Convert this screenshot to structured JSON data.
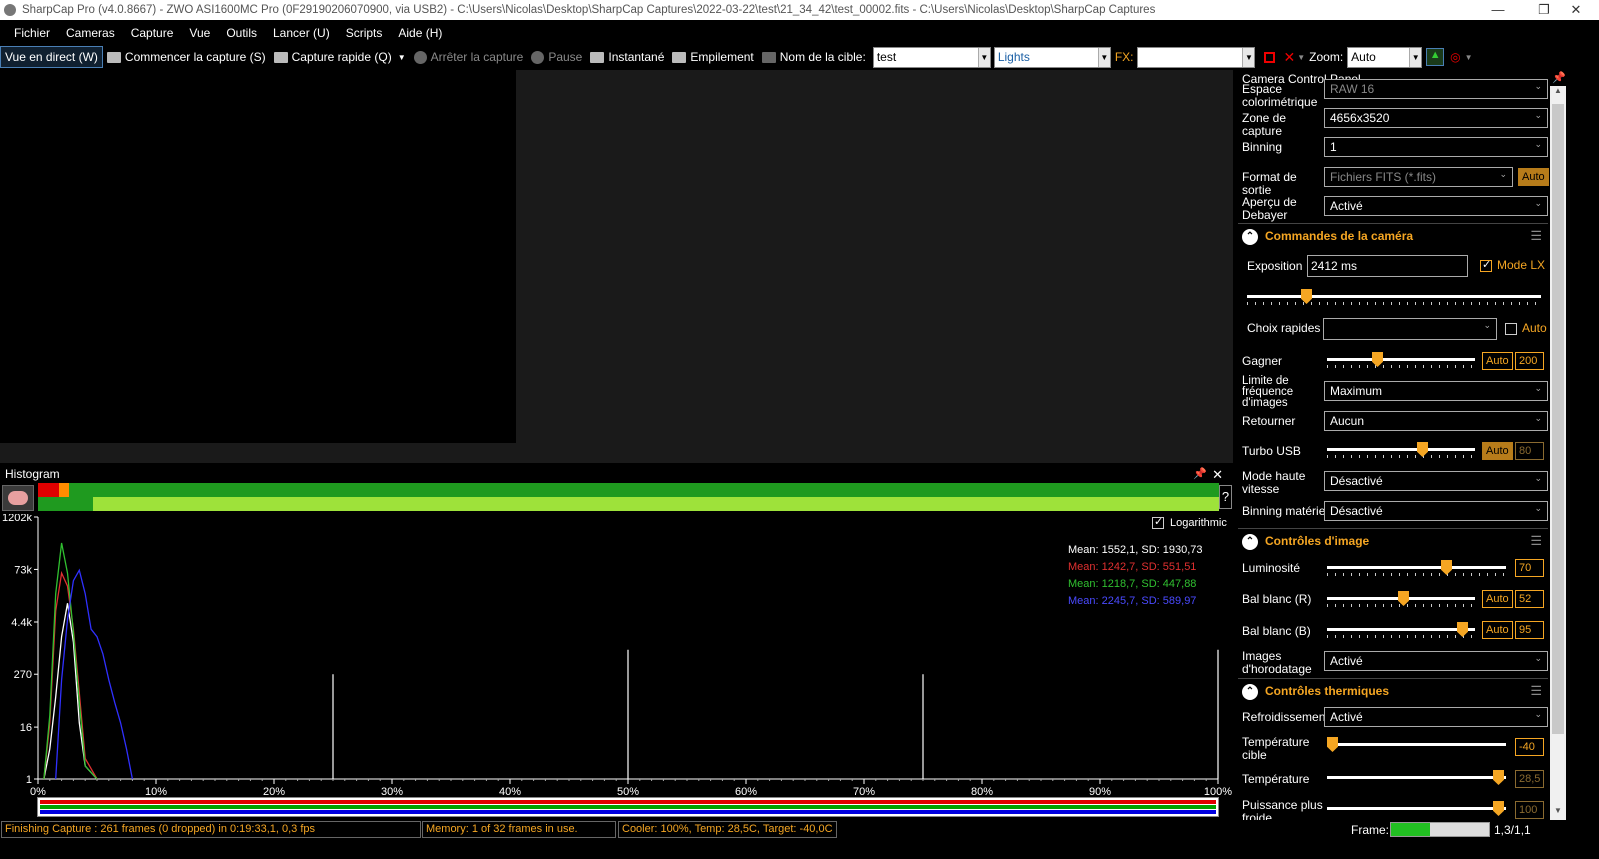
{
  "titlebar": {
    "title": "SharpCap Pro (v4.0.8667) - ZWO ASI1600MC Pro (0F29190206070900, via USB2) - C:\\Users\\Nicolas\\Desktop\\SharpCap Captures\\2022-03-22\\test\\21_34_42\\test_00002.fits - C:\\Users\\Nicolas\\Desktop\\SharpCap Captures",
    "minimize": "—",
    "maximize": "❐",
    "close": "✕"
  },
  "menu": [
    "Fichier",
    "Cameras",
    "Capture",
    "Vue",
    "Outils",
    "Lancer (U)",
    "Scripts",
    "Aide (H)"
  ],
  "toolbar": {
    "live_view": "Vue en direct (W)",
    "start_capture": "Commencer la capture (S)",
    "quick_capture": "Capture rapide (Q)",
    "stop_capture": "Arrêter la capture",
    "pause": "Pause",
    "snapshot": "Instantané",
    "stacking": "Empilement",
    "target_label": "Nom de la cible:",
    "target_value": "test",
    "frame_type": "Lights",
    "fx_label": "FX:",
    "fx_value": "",
    "zoom_label": "Zoom:",
    "zoom_value": "Auto"
  },
  "histogram": {
    "title": "Histogram",
    "pin": "📌",
    "close": "✕",
    "help": "?",
    "logarithmic_label": "Logarithmic",
    "logarithmic": true,
    "stats": [
      {
        "text": "Mean: 1552,1, SD: 1930,73",
        "color": "#ffffff"
      },
      {
        "text": "Mean: 1242,7, SD: 551,51",
        "color": "#e03030"
      },
      {
        "text": "Mean: 1218,7, SD: 447,88",
        "color": "#30c030"
      },
      {
        "text": "Mean: 2245,7, SD: 589,97",
        "color": "#4040ff"
      }
    ]
  },
  "chart_data": {
    "type": "line",
    "x_ticks": [
      "0%",
      "10%",
      "20%",
      "30%",
      "40%",
      "50%",
      "60%",
      "70%",
      "80%",
      "90%",
      "100%"
    ],
    "y_ticks": [
      "1202k",
      "73k",
      "4.4k",
      "270",
      "16",
      "1"
    ],
    "xlim": [
      0,
      100
    ],
    "log_scale": true,
    "series": [
      {
        "color": "#ffffff",
        "x": [
          0.5,
          1,
          1.5,
          2,
          2.5,
          3,
          3.5,
          4,
          5
        ],
        "y": [
          1,
          5,
          80,
          2000,
          12000,
          1500,
          20,
          2,
          1
        ]
      },
      {
        "color": "#e03030",
        "x": [
          0.5,
          1,
          1.5,
          2,
          2.5,
          3,
          3.5,
          4,
          5
        ],
        "y": [
          1,
          20,
          8000,
          60000,
          30000,
          3000,
          100,
          3,
          1
        ]
      },
      {
        "color": "#30c030",
        "x": [
          0.5,
          1,
          1.5,
          2,
          2.5,
          3,
          3.5,
          4,
          5
        ],
        "y": [
          1,
          30,
          20000,
          300000,
          60000,
          2500,
          60,
          2,
          1
        ]
      },
      {
        "color": "#3030ff",
        "x": [
          1.5,
          2,
          2.5,
          3,
          3.5,
          4,
          4.5,
          5,
          5.5,
          6,
          6.5,
          7,
          7.5,
          8
        ],
        "y": [
          1,
          200,
          5000,
          40000,
          70000,
          20000,
          3000,
          2000,
          800,
          200,
          60,
          20,
          5,
          1
        ]
      }
    ],
    "spikes": [
      {
        "x": 25,
        "y": 270,
        "color": "#ffffff"
      },
      {
        "x": 50,
        "y": 1000,
        "color": "#ffffff"
      },
      {
        "x": 75,
        "y": 270,
        "color": "#ffffff"
      },
      {
        "x": 100,
        "y": 1000,
        "color": "#ffffff"
      }
    ]
  },
  "status": {
    "capture": "Finishing Capture : 261 frames (0 dropped) in 0:19:33,1, 0,3 fps",
    "memory": "Memory: 1 of 32 frames in use.",
    "cooler": "Cooler: 100%, Temp: 28,5C, Target: -40,0C",
    "frame_label": "Frame:",
    "frame_value": "1,3/1,1",
    "frame_fill": 0.4
  },
  "panel": {
    "title": "Camera Control Panel",
    "top": [
      {
        "label": "Espace colorimétrique",
        "value": "RAW 16"
      },
      {
        "label": "Zone de capture",
        "value": "4656x3520"
      },
      {
        "label": "Binning",
        "value": "1"
      },
      {
        "label": "Format de sortie",
        "value": "Fichiers FITS (*.fits)",
        "extra": "Auto"
      },
      {
        "label": "Aperçu de Debayer",
        "value": "Activé"
      }
    ],
    "camera_section": "Commandes de la caméra",
    "exposure_label": "Exposition",
    "exposure_value": "2412 ms",
    "lx_label": "Mode LX",
    "lx_checked": true,
    "exposure_level": 0.19,
    "quick_label": "Choix rapides",
    "quick_value": "",
    "quick_auto": "Auto",
    "gain": {
      "label": "Gagner",
      "auto": "Auto",
      "value": "200",
      "level": 0.33
    },
    "framerate": {
      "label": "Limite de fréquence d'images",
      "value": "Maximum"
    },
    "flip": {
      "label": "Retourner",
      "value": "Aucun"
    },
    "usb": {
      "label": "Turbo USB",
      "auto": "Auto",
      "value": "80",
      "level": 0.66
    },
    "highspeed": {
      "label": "Mode haute vitesse",
      "value": "Désactivé"
    },
    "hwbin": {
      "label": "Binning matériel",
      "value": "Désactivé"
    },
    "image_section": "Contrôles d'image",
    "brightness": {
      "label": "Luminosité",
      "value": "70",
      "level": 0.68
    },
    "wbr": {
      "label": "Bal blanc (R)",
      "auto": "Auto",
      "value": "52",
      "level": 0.52
    },
    "wbb": {
      "label": "Bal blanc (B)",
      "auto": "Auto",
      "value": "95",
      "level": 0.95
    },
    "timestamp": {
      "label": "Images d'horodatage",
      "value": "Activé"
    },
    "thermal_section": "Contrôles thermiques",
    "cooling": {
      "label": "Refroidissement",
      "value": "Activé"
    },
    "target_temp": {
      "label": "Température cible",
      "value": "-40",
      "level": 0.0
    },
    "temperature": {
      "label": "Température",
      "value": "28,5",
      "level": 0.99
    },
    "cooler_power": {
      "label": "Puissance plus froide",
      "value": "100",
      "level": 0.99
    }
  }
}
